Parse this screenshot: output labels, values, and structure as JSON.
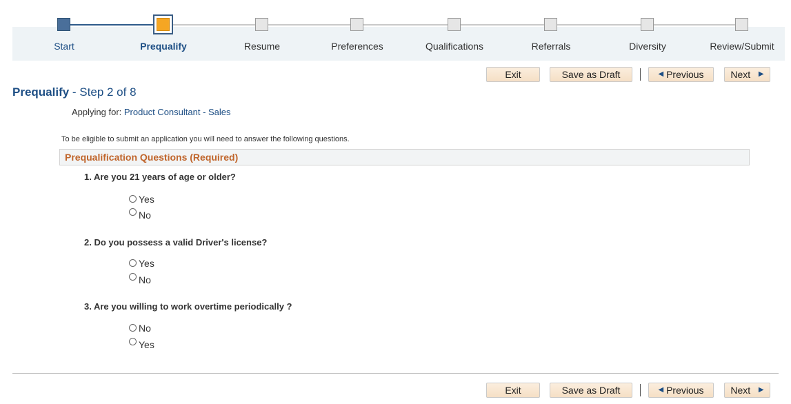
{
  "train": {
    "steps": [
      {
        "label": "Start",
        "state": "done"
      },
      {
        "label": "Prequalify",
        "state": "current"
      },
      {
        "label": "Resume",
        "state": "todo"
      },
      {
        "label": "Preferences",
        "state": "todo"
      },
      {
        "label": "Qualifications",
        "state": "todo"
      },
      {
        "label": "Referrals",
        "state": "todo"
      },
      {
        "label": "Diversity",
        "state": "todo"
      },
      {
        "label": "Review/Submit",
        "state": "todo"
      }
    ]
  },
  "buttons": {
    "exit": "Exit",
    "save_draft": "Save as Draft",
    "previous": "Previous",
    "next": "Next"
  },
  "page": {
    "title": "Prequalify",
    "step_text": " - Step 2 of 8",
    "applying_label": "Applying for:",
    "job_title": "Product Consultant - Sales",
    "instructions": "To be eligible to submit an application you will need to answer the following questions.",
    "section_title": "Prequalification Questions (Required)"
  },
  "questions": [
    {
      "text": "1. Are you 21 years of age or older?",
      "options": [
        "Yes",
        "No"
      ]
    },
    {
      "text": "2. Do you possess a valid Driver's license?",
      "options": [
        "Yes",
        "No"
      ]
    },
    {
      "text": "3. Are you willing to work overtime periodically ?",
      "options": [
        "No",
        "Yes"
      ]
    }
  ],
  "colors": {
    "accent_blue": "#1e4f85",
    "current_step": "#f5a623",
    "section_title": "#c0652b",
    "button_bg": "#f5dfc5"
  }
}
